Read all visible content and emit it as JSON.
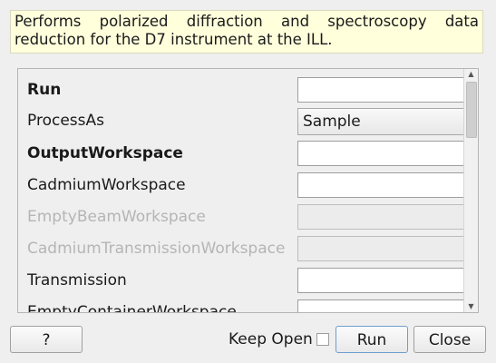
{
  "description": "Performs polarized diffraction and spectroscopy data reduction for the D7 instrument at the ILL.",
  "properties": [
    {
      "label": "Run",
      "style": "bold",
      "control": "input",
      "value": ""
    },
    {
      "label": "ProcessAs",
      "style": "normal",
      "control": "select",
      "value": "Sample"
    },
    {
      "label": "OutputWorkspace",
      "style": "bold",
      "control": "input",
      "value": ""
    },
    {
      "label": "CadmiumWorkspace",
      "style": "normal",
      "control": "input",
      "value": ""
    },
    {
      "label": "EmptyBeamWorkspace",
      "style": "disabled",
      "control": "input",
      "value": ""
    },
    {
      "label": "CadmiumTransmissionWorkspace",
      "style": "disabled",
      "control": "input",
      "value": ""
    },
    {
      "label": "Transmission",
      "style": "normal",
      "control": "input",
      "value": ""
    },
    {
      "label": "EmptyContainerWorkspace",
      "style": "normal",
      "control": "input",
      "value": ""
    }
  ],
  "buttons": {
    "help": "?",
    "keep_open": "Keep Open",
    "keep_open_checked": false,
    "run": "Run",
    "close": "Close"
  },
  "scrollbar_icons": {
    "up": "arrow-up-icon",
    "down": "arrow-down-icon"
  }
}
